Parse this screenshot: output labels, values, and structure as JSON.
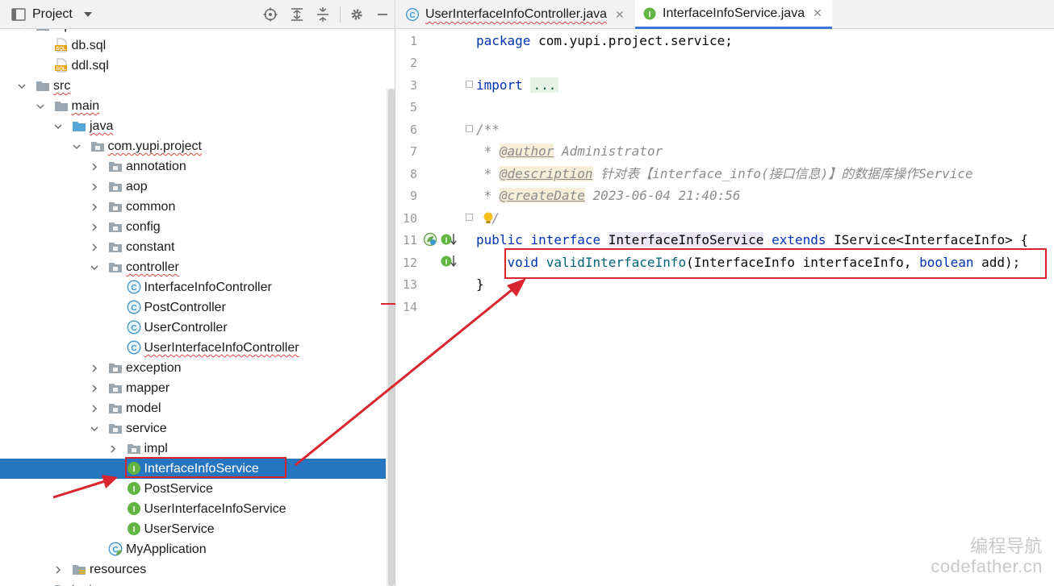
{
  "project_panel": {
    "title": "Project",
    "tree": [
      {
        "label": "sql",
        "type": "folder",
        "depth": 1
      },
      {
        "label": "db.sql",
        "type": "sql-file",
        "depth": 2
      },
      {
        "label": "ddl.sql",
        "type": "sql-file",
        "depth": 2
      },
      {
        "label": "src",
        "type": "folder",
        "depth": 1,
        "expanded": true
      },
      {
        "label": "main",
        "type": "folder",
        "depth": 2,
        "expanded": true
      },
      {
        "label": "java",
        "type": "source-folder",
        "depth": 3,
        "expanded": true
      },
      {
        "label": "com.yupi.project",
        "type": "package",
        "depth": 4,
        "expanded": true
      },
      {
        "label": "annotation",
        "type": "package",
        "depth": 5
      },
      {
        "label": "aop",
        "type": "package",
        "depth": 5
      },
      {
        "label": "common",
        "type": "package",
        "depth": 5
      },
      {
        "label": "config",
        "type": "package",
        "depth": 5
      },
      {
        "label": "constant",
        "type": "package",
        "depth": 5
      },
      {
        "label": "controller",
        "type": "package",
        "depth": 5,
        "expanded": true
      },
      {
        "label": "InterfaceInfoController",
        "type": "class",
        "depth": 6
      },
      {
        "label": "PostController",
        "type": "class",
        "depth": 6
      },
      {
        "label": "UserController",
        "type": "class",
        "depth": 6
      },
      {
        "label": "UserInterfaceInfoController",
        "type": "class",
        "depth": 6
      },
      {
        "label": "exception",
        "type": "package",
        "depth": 5
      },
      {
        "label": "mapper",
        "type": "package",
        "depth": 5
      },
      {
        "label": "model",
        "type": "package",
        "depth": 5
      },
      {
        "label": "service",
        "type": "package",
        "depth": 5,
        "expanded": true
      },
      {
        "label": "impl",
        "type": "package",
        "depth": 6
      },
      {
        "label": "InterfaceInfoService",
        "type": "interface",
        "depth": 6,
        "selected": true
      },
      {
        "label": "PostService",
        "type": "interface",
        "depth": 6
      },
      {
        "label": "UserInterfaceInfoService",
        "type": "interface",
        "depth": 6
      },
      {
        "label": "UserService",
        "type": "interface",
        "depth": 6
      },
      {
        "label": "MyApplication",
        "type": "spring-class",
        "depth": 5
      },
      {
        "label": "resources",
        "type": "resources-folder",
        "depth": 3
      },
      {
        "label": "test",
        "type": "folder",
        "depth": 2
      }
    ]
  },
  "editor": {
    "tabs": [
      {
        "label": "UserInterfaceInfoController.java",
        "type": "class",
        "active": false
      },
      {
        "label": "InterfaceInfoService.java",
        "type": "interface",
        "active": true
      }
    ],
    "line_numbers": [
      "1",
      "2",
      "3",
      "5",
      "6",
      "7",
      "8",
      "9",
      "10",
      "11",
      "12",
      "13",
      "14"
    ],
    "code": {
      "l1_kw": "package",
      "l1_rest": " com.yupi.project.service;",
      "l3_kw": "import",
      "l3_dots": "...",
      "l6": "/**",
      "l7_star": " * ",
      "l7_tag": "@author",
      "l7_rest": " Administrator",
      "l8_star": " * ",
      "l8_tag": "@description",
      "l8_rest": " 针对表【interface_info(接口信息)】的数据库操作Service",
      "l9_star": " * ",
      "l9_tag": "@createDate",
      "l9_rest": " 2023-06-04 21:40:56",
      "l10": " */",
      "l11_kw1": "public",
      "l11_kw2": "interface",
      "l11_name": "InterfaceInfoService",
      "l11_kw3": "extends",
      "l11_rest": "IService<InterfaceInfo> {",
      "l12_kw1": "void",
      "l12_fn": "validInterfaceInfo",
      "l12_a": "(InterfaceInfo interfaceInfo, ",
      "l12_kw2": "boolean",
      "l12_b": " add);",
      "l13": "}"
    }
  },
  "watermark": {
    "line1": "编程导航",
    "line2": "codefather.cn"
  },
  "colors": {
    "selection": "#2675bf",
    "annotation_red": "#d9262e",
    "keyword": "#0033b3",
    "method": "#00627a",
    "comment": "#8c8c8c"
  }
}
